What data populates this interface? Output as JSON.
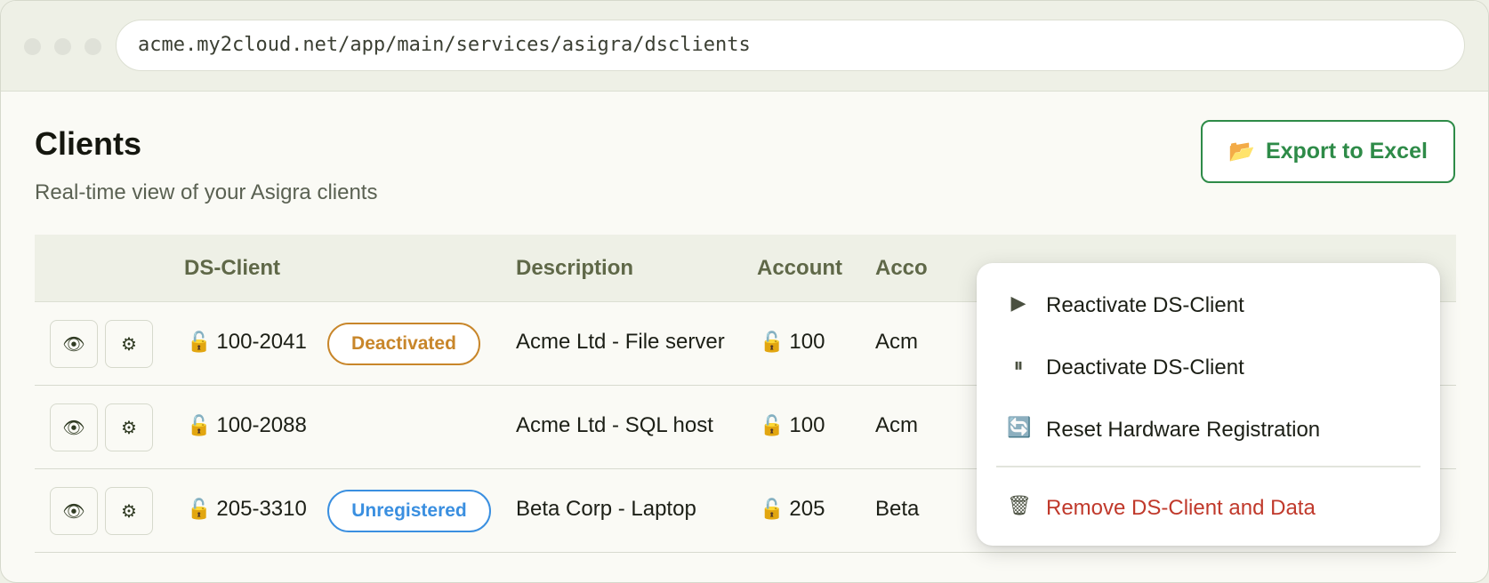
{
  "browser": {
    "url": "acme.my2cloud.net/app/main/services/asigra/dsclients"
  },
  "header": {
    "title": "Clients",
    "subtitle": "Real-time view of your Asigra clients",
    "export_label": "Export to Excel"
  },
  "table": {
    "columns": [
      "DS-Client",
      "Description",
      "Account",
      "Acco"
    ],
    "rows": [
      {
        "client": "100-2041",
        "badge": "Deactivated",
        "description": "Acme Ltd - File server",
        "account": "100",
        "account_name": "Acm"
      },
      {
        "client": "100-2088",
        "badge": "",
        "description": "Acme Ltd - SQL host",
        "account": "100",
        "account_name": "Acm"
      },
      {
        "client": "205-3310",
        "badge": "Unregistered",
        "description": "Beta Corp - Laptop",
        "account": "205",
        "account_name": "Beta"
      }
    ]
  },
  "context_menu": {
    "items": [
      {
        "label": "Reactivate DS-Client",
        "icon": "play-icon"
      },
      {
        "label": "Deactivate DS-Client",
        "icon": "pause-icon"
      },
      {
        "label": "Reset Hardware Registration",
        "icon": "refresh-icon"
      },
      {
        "label": "Remove DS-Client and Data",
        "icon": "trash-icon"
      }
    ]
  },
  "colors": {
    "accent_green": "#2e8b48",
    "badge_deactivated": "#c8862a",
    "badge_unregistered": "#3a8fe0",
    "danger": "#c0392b"
  }
}
